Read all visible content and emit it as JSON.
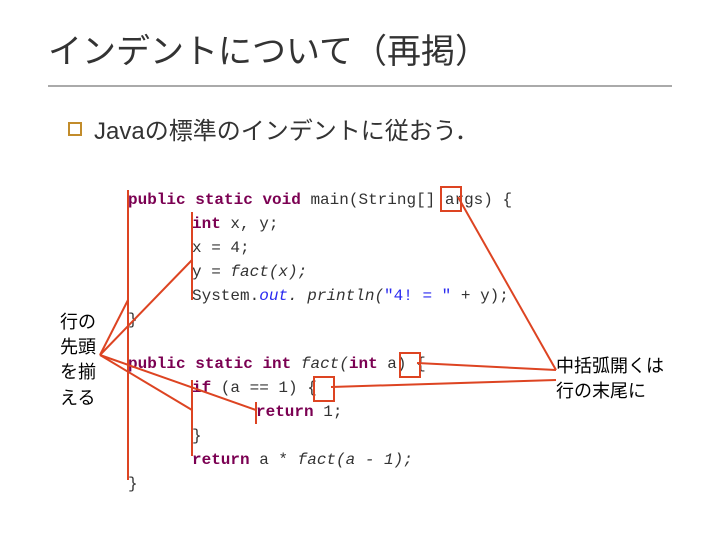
{
  "title": "インデントについて（再掲）",
  "bullet": "Javaの標準のインデントに従おう．",
  "code": {
    "public": "public",
    "static": "static",
    "void": "void",
    "int": "int",
    "if": "if",
    "return": "return",
    "main_sig": "main(String[] args)",
    "brace_open": "{",
    "brace_close": "}",
    "int_xy": "x, y;",
    "x_assign": "x = 4;",
    "y_assign": "y = ",
    "fact_call_x": "fact(x);",
    "system": "System.",
    "out": "out",
    "print_call": ". println(",
    "str_lit": "\"4! = \"",
    "plus_y": " + y);",
    "fact_sig": "fact(",
    "param_a": " a)",
    "cond": " (a == 1) ",
    "ret1": " 1;",
    "ret_mul1": " a * ",
    "ret_mul2": "fact(a - 1);"
  },
  "note_left": {
    "l1": "行の",
    "l2": "先頭",
    "l3": "を揃",
    "l4": "える"
  },
  "note_right": {
    "l1": "中括弧開くは",
    "l2": "行の末尾に"
  }
}
